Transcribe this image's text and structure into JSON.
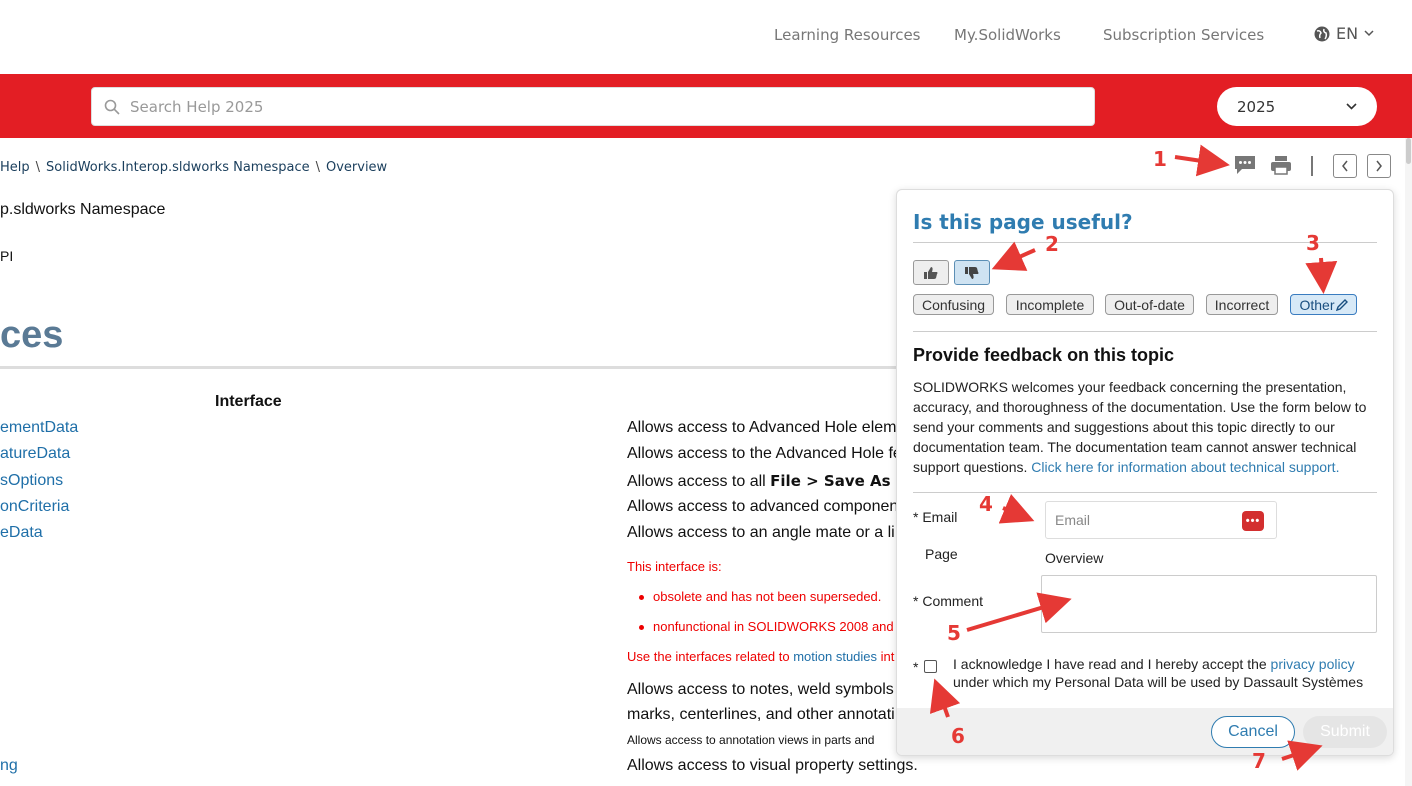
{
  "topnav": {
    "links": [
      "Learning Resources",
      "My.SolidWorks",
      "Subscription Services"
    ],
    "language": "EN"
  },
  "search": {
    "placeholder": "Search Help 2025"
  },
  "version": {
    "selected": "2025"
  },
  "breadcrumb": [
    "Help",
    "SolidWorks.Interop.sldworks Namespace",
    "Overview"
  ],
  "content": {
    "namespace_fragment": "p.sldworks Namespace",
    "pi_fragment": "PI",
    "heading_fragment": "ces",
    "column_header": "Interface",
    "interfaces": [
      "ementData",
      "atureData",
      "sOptions",
      "onCriteria",
      "eData",
      "ng"
    ],
    "descriptions": [
      {
        "pre": "Allows access to Advanced Hole elem",
        "bold": ""
      },
      {
        "pre": "Allows access to the Advanced Hole fe",
        "bold": ""
      },
      {
        "pre": "Allows access to all ",
        "bold": "File > Save As"
      },
      {
        "pre": "Allows access to advanced componen",
        "bold": ""
      },
      {
        "pre": "Allows access to an angle mate or a li",
        "bold": ""
      }
    ],
    "obsolete_intro": "This interface is:",
    "obsolete_items": [
      "obsolete and has not been superseded.",
      "nonfunctional in SOLIDWORKS 2008 and"
    ],
    "use_related_pre": "Use the interfaces related to ",
    "use_related_link": "motion studies",
    "use_related_post": " int",
    "notes_line1": "Allows access to notes, weld symbols",
    "notes_line2": "marks, centerlines, and other annotati",
    "annotation_views": "Allows access to annotation views in parts and",
    "visual_props": "Allows access to visual property settings."
  },
  "feedback": {
    "title": "Is this page useful?",
    "reasons": [
      "Confusing",
      "Incomplete",
      "Out-of-date",
      "Incorrect",
      "Other"
    ],
    "section_title": "Provide feedback on this topic",
    "intro_text": "SOLIDWORKS welcomes your feedback concerning the presentation, accuracy, and thoroughness of the documentation. Use the form below to send your comments and suggestions about this topic directly to our documentation team. The documentation team cannot answer technical support questions. ",
    "support_link": "Click here for information about technical support.",
    "email_label": "* Email",
    "email_placeholder": "Email",
    "page_label": "Page",
    "page_value": "Overview",
    "comment_label": "* Comment",
    "ack_star": "*",
    "ack_pre": "I acknowledge I have read and I hereby accept the ",
    "ack_link": "privacy policy",
    "ack_post": " under which my Personal Data will be used by Dassault Systèmes",
    "cancel_label": "Cancel",
    "submit_label": "Submit"
  },
  "annotations": [
    "1",
    "2",
    "3",
    "4",
    "5",
    "6",
    "7"
  ],
  "colors": {
    "brand_red": "#e31e24",
    "link_blue": "#2f7cb0",
    "annotation_red": "#e53935"
  }
}
